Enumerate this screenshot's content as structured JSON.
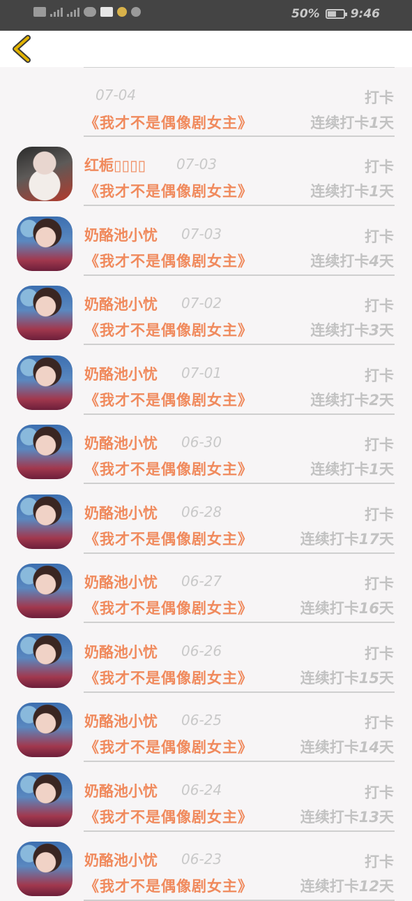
{
  "status_bar": {
    "battery": "50%",
    "time": "9:46",
    "net": "4G"
  },
  "nav": {
    "back_icon": "chevron-left-icon"
  },
  "partial_row": {
    "date": "07-04",
    "action": "打卡",
    "book": "《我才不是偶像剧女主》",
    "streak_prefix": "连续打卡",
    "streak_days": "1",
    "streak_suffix": "天"
  },
  "rows": [
    {
      "name": "红栀▯▯▯▯",
      "date": "07-03",
      "action": "打卡",
      "book": "《我才不是偶像剧女主》",
      "streak_prefix": "连续打卡",
      "streak_days": "1",
      "streak_suffix": "天"
    },
    {
      "name": "奶酪池小忧",
      "date": "07-03",
      "action": "打卡",
      "book": "《我才不是偶像剧女主》",
      "streak_prefix": "连续打卡",
      "streak_days": "4",
      "streak_suffix": "天"
    },
    {
      "name": "奶酪池小忧",
      "date": "07-02",
      "action": "打卡",
      "book": "《我才不是偶像剧女主》",
      "streak_prefix": "连续打卡",
      "streak_days": "3",
      "streak_suffix": "天"
    },
    {
      "name": "奶酪池小忧",
      "date": "07-01",
      "action": "打卡",
      "book": "《我才不是偶像剧女主》",
      "streak_prefix": "连续打卡",
      "streak_days": "2",
      "streak_suffix": "天"
    },
    {
      "name": "奶酪池小忧",
      "date": "06-30",
      "action": "打卡",
      "book": "《我才不是偶像剧女主》",
      "streak_prefix": "连续打卡",
      "streak_days": "1",
      "streak_suffix": "天"
    },
    {
      "name": "奶酪池小忧",
      "date": "06-28",
      "action": "打卡",
      "book": "《我才不是偶像剧女主》",
      "streak_prefix": "连续打卡",
      "streak_days": "17",
      "streak_suffix": "天"
    },
    {
      "name": "奶酪池小忧",
      "date": "06-27",
      "action": "打卡",
      "book": "《我才不是偶像剧女主》",
      "streak_prefix": "连续打卡",
      "streak_days": "16",
      "streak_suffix": "天"
    },
    {
      "name": "奶酪池小忧",
      "date": "06-26",
      "action": "打卡",
      "book": "《我才不是偶像剧女主》",
      "streak_prefix": "连续打卡",
      "streak_days": "15",
      "streak_suffix": "天"
    },
    {
      "name": "奶酪池小忧",
      "date": "06-25",
      "action": "打卡",
      "book": "《我才不是偶像剧女主》",
      "streak_prefix": "连续打卡",
      "streak_days": "14",
      "streak_suffix": "天"
    },
    {
      "name": "奶酪池小忧",
      "date": "06-24",
      "action": "打卡",
      "book": "《我才不是偶像剧女主》",
      "streak_prefix": "连续打卡",
      "streak_days": "13",
      "streak_suffix": "天"
    },
    {
      "name": "奶酪池小忧",
      "date": "06-23",
      "action": "打卡",
      "book": "《我才不是偶像剧女主》",
      "streak_prefix": "连续打卡",
      "streak_days": "12",
      "streak_suffix": "天"
    }
  ],
  "colors": {
    "accent": "#f08a5d",
    "muted": "#c2c2c2",
    "statusbar": "#444444",
    "back_icon": "#d4a100"
  }
}
